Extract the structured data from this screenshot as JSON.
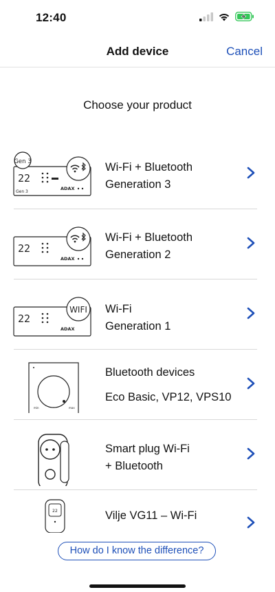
{
  "status_bar": {
    "time": "12:40",
    "icons": [
      "cellular-signal-icon",
      "wifi-icon",
      "battery-charging-icon"
    ]
  },
  "nav": {
    "title": "Add device",
    "cancel_label": "Cancel"
  },
  "subtitle": "Choose your product",
  "devices": [
    {
      "line1": "Wi-Fi + Bluetooth",
      "line2": "Generation 3",
      "thumb_badge": "Gen 3",
      "thumb_display": "22",
      "icon": "wifi-bluetooth-icon"
    },
    {
      "line1": "Wi-Fi + Bluetooth",
      "line2": "Generation 2",
      "thumb_display": "22",
      "icon": "wifi-bluetooth-icon"
    },
    {
      "line1": "Wi-Fi",
      "line2": "Generation 1",
      "thumb_display": "22",
      "thumb_badge": "WIFI",
      "icon": "wifi-badge-icon"
    },
    {
      "line1": "Bluetooth devices",
      "line2": "Eco Basic, VP12, VPS10",
      "icon": "thermostat-dial-icon"
    },
    {
      "line1": "Smart plug Wi-Fi",
      "line2": "+ Bluetooth",
      "icon": "smart-plug-icon"
    },
    {
      "line1": "Vilje VG11 – Wi-Fi",
      "icon": "vilje-device-icon"
    }
  ],
  "help_button_label": "How do I know the difference?",
  "colors": {
    "accent": "#1d4fb8",
    "battery": "#34c759",
    "separator": "#d8d8d8"
  }
}
